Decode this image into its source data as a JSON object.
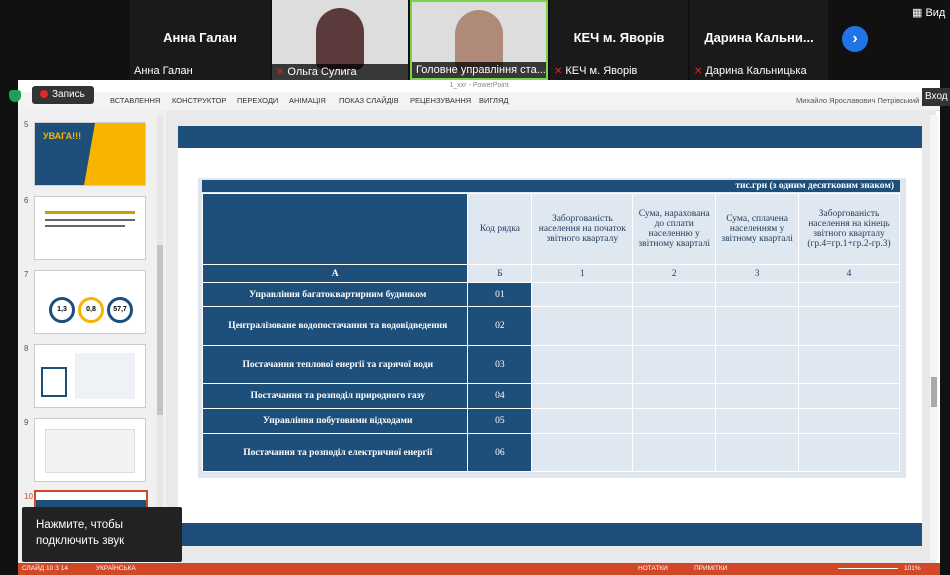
{
  "zoom": {
    "participants": [
      {
        "display_name": "Анна Галан",
        "label": "Анна Галан"
      },
      {
        "label": "Ольга Сулига"
      },
      {
        "label": "Головне управління ста..."
      },
      {
        "display_name": "КЕЧ м. Яворів",
        "label": "КЕЧ м. Яворів"
      },
      {
        "display_name": "Дарина  Кальни...",
        "label": "Дарина Кальницька"
      }
    ],
    "view_label": "Вид",
    "recording_label": "Запись",
    "enter_label": "Вход",
    "audio_toast": "Нажмите, чтобы подключить звук"
  },
  "ppt": {
    "window_title": "1_ххг - PowerPoint",
    "user_name": "Михайло Ярославович Петрівський",
    "ribbon_tabs": [
      "ВСТАВЛЕННЯ",
      "КОНСТРУКТОР",
      "ПЕРЕХОДИ",
      "АНІМАЦІЯ",
      "ПОКАЗ СЛАЙДІВ",
      "РЕЦЕНЗУВАННЯ",
      "ВИГЛЯД"
    ],
    "thumbnails": [
      {
        "num": "5",
        "title": "УВАГА!!!"
      },
      {
        "num": "6"
      },
      {
        "num": "7",
        "values": [
          "1,3",
          "0,8",
          "57,7"
        ]
      },
      {
        "num": "8"
      },
      {
        "num": "9"
      },
      {
        "num": "10"
      }
    ],
    "status": {
      "slide_info": "СЛАЙД 10 З 14",
      "language": "УКРАЇНСЬКА",
      "notes": "НОТАТКИ",
      "comments": "ПРИМІТКИ",
      "zoom": "101%"
    }
  },
  "slide": {
    "unit_note": "тис.грн (з одним десятковим знаком)",
    "headers": {
      "code": "Код рядка",
      "col1": "Заборгованість населення на початок звітного кварталу",
      "col2": "Сума, нарахована до сплати населенню у звітному кварталі",
      "col3": "Сума, сплачена населенням у звітному кварталі",
      "col4": "Заборгованість населення на кінець звітного кварталу (гр.4=гр.1+гр.2-гр.3)"
    },
    "index_row": {
      "a": "А",
      "b": "Б",
      "c1": "1",
      "c2": "2",
      "c3": "3",
      "c4": "4"
    },
    "rows": [
      {
        "label": "Управління багатоквартирним будинком",
        "code": "01"
      },
      {
        "label": "Централізоване водопостачання та водовідведення",
        "code": "02"
      },
      {
        "label": "Постачання теплової енергії та гарячої води",
        "code": "03"
      },
      {
        "label": "Постачання та розподіл природного газу",
        "code": "04"
      },
      {
        "label": "Управління побутовими відходами",
        "code": "05"
      },
      {
        "label": "Постачання та розподіл електричної енергії",
        "code": "06"
      }
    ]
  }
}
